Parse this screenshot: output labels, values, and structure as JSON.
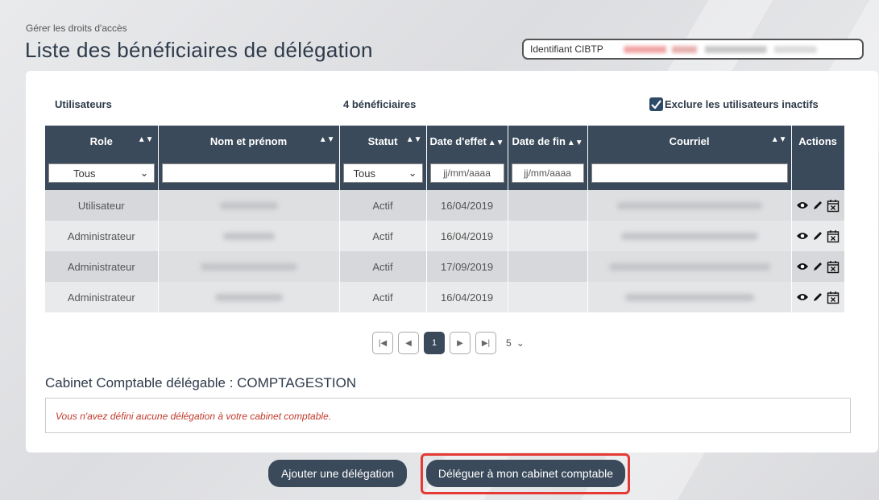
{
  "breadcrumb": "Gérer les droits d'accès",
  "page_title": "Liste des bénéficiaires de délégation",
  "cibtp": {
    "label": "Identifiant CIBTP"
  },
  "list": {
    "users_label": "Utilisateurs",
    "count_label": "4 bénéficiaires",
    "exclude_label": "Exclure les utilisateurs inactifs",
    "exclude_checked": true
  },
  "columns": {
    "role": "Role",
    "name": "Nom et prénom",
    "statut": "Statut",
    "date_effet": "Date d'effet",
    "date_fin": "Date de fin",
    "courriel": "Courriel",
    "actions": "Actions"
  },
  "filters": {
    "role_value": "Tous",
    "statut_value": "Tous",
    "date_effet_placeholder": "jj/mm/aaaa",
    "date_fin_placeholder": "jj/mm/aaaa"
  },
  "rows": [
    {
      "role": "Utilisateur",
      "statut": "Actif",
      "date_effet": "16/04/2019",
      "date_fin": ""
    },
    {
      "role": "Administrateur",
      "statut": "Actif",
      "date_effet": "16/04/2019",
      "date_fin": ""
    },
    {
      "role": "Administrateur",
      "statut": "Actif",
      "date_effet": "17/09/2019",
      "date_fin": ""
    },
    {
      "role": "Administrateur",
      "statut": "Actif",
      "date_effet": "16/04/2019",
      "date_fin": ""
    }
  ],
  "pagination": {
    "current_page": "1",
    "page_size": "5"
  },
  "cabinet": {
    "title": "Cabinet Comptable délégable : COMPTAGESTION",
    "message": "Vous n'avez défini aucune délégation à votre cabinet comptable."
  },
  "buttons": {
    "add_delegation": "Ajouter une délégation",
    "delegate_cabinet": "Déléguer à mon cabinet comptable"
  },
  "colors": {
    "header_bg": "#3a4a5b",
    "highlight": "#e53935",
    "error_text": "#c0392b"
  }
}
